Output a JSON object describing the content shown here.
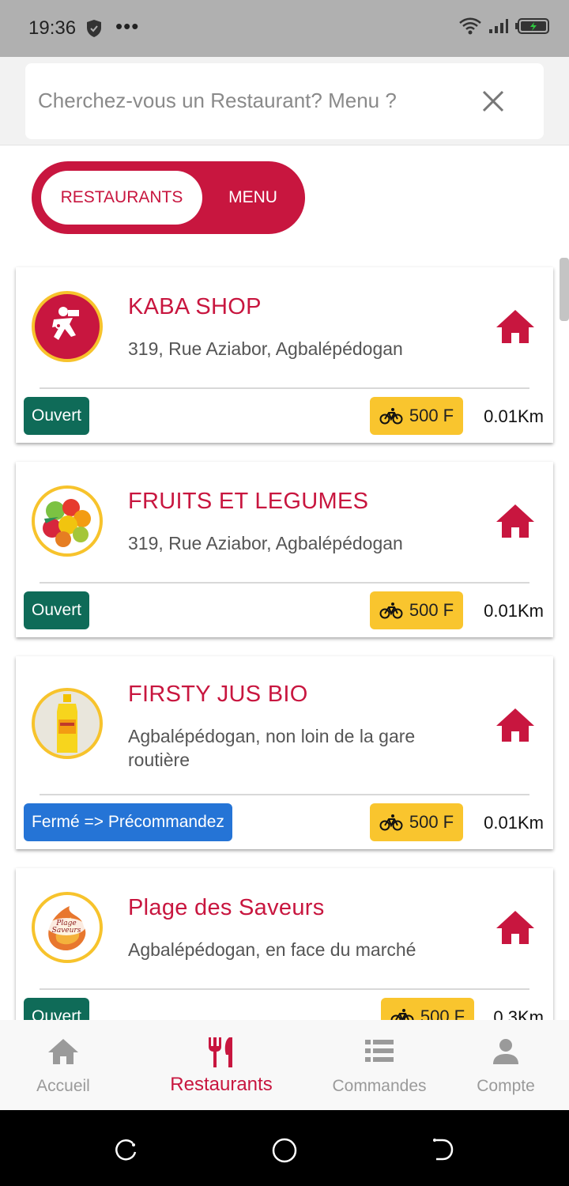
{
  "status_bar": {
    "time": "19:36",
    "dots": "•••"
  },
  "search": {
    "placeholder": "Cherchez-vous un Restaurant? Menu ?"
  },
  "toggle": {
    "active_label": "RESTAURANTS",
    "inactive_label": "MENU"
  },
  "colors": {
    "brand": "#c8163f",
    "open": "#0f6b58",
    "closed": "#2574d6",
    "fee": "#f9c52e",
    "logo_border": "#f7c32c"
  },
  "restaurants": [
    {
      "name": "KABA SHOP",
      "address": "319, Rue Aziabor, Agbalépédogan",
      "status": "Ouvert",
      "fee": "500 F",
      "distance": "0.01Km",
      "logo_icon": "delivery-man-icon"
    },
    {
      "name": "FRUITS ET LEGUMES",
      "address": "319, Rue Aziabor, Agbalépédogan",
      "status": "Ouvert",
      "fee": "500 F",
      "distance": "0.01Km",
      "logo_icon": "fruits-vegetables-image"
    },
    {
      "name": "FIRSTY JUS BIO",
      "address": "Agbalépédogan, non loin de la gare routière",
      "status": "Fermé => Précommandez",
      "fee": "500 F",
      "distance": "0.01Km",
      "logo_icon": "juice-bottle-image"
    },
    {
      "name": "Plage des Saveurs",
      "address": "Agbalépédogan, en face du marché",
      "status": "Ouvert",
      "fee": "500 F",
      "distance": "0.3Km",
      "logo_icon": "plage-des-saveurs-logo"
    }
  ],
  "bottom_nav": [
    {
      "label": "Accueil",
      "icon": "home-icon"
    },
    {
      "label": "Restaurants",
      "icon": "fork-knife-icon",
      "active": true
    },
    {
      "label": "Commandes",
      "icon": "list-icon"
    },
    {
      "label": "Compte",
      "icon": "person-icon"
    }
  ]
}
